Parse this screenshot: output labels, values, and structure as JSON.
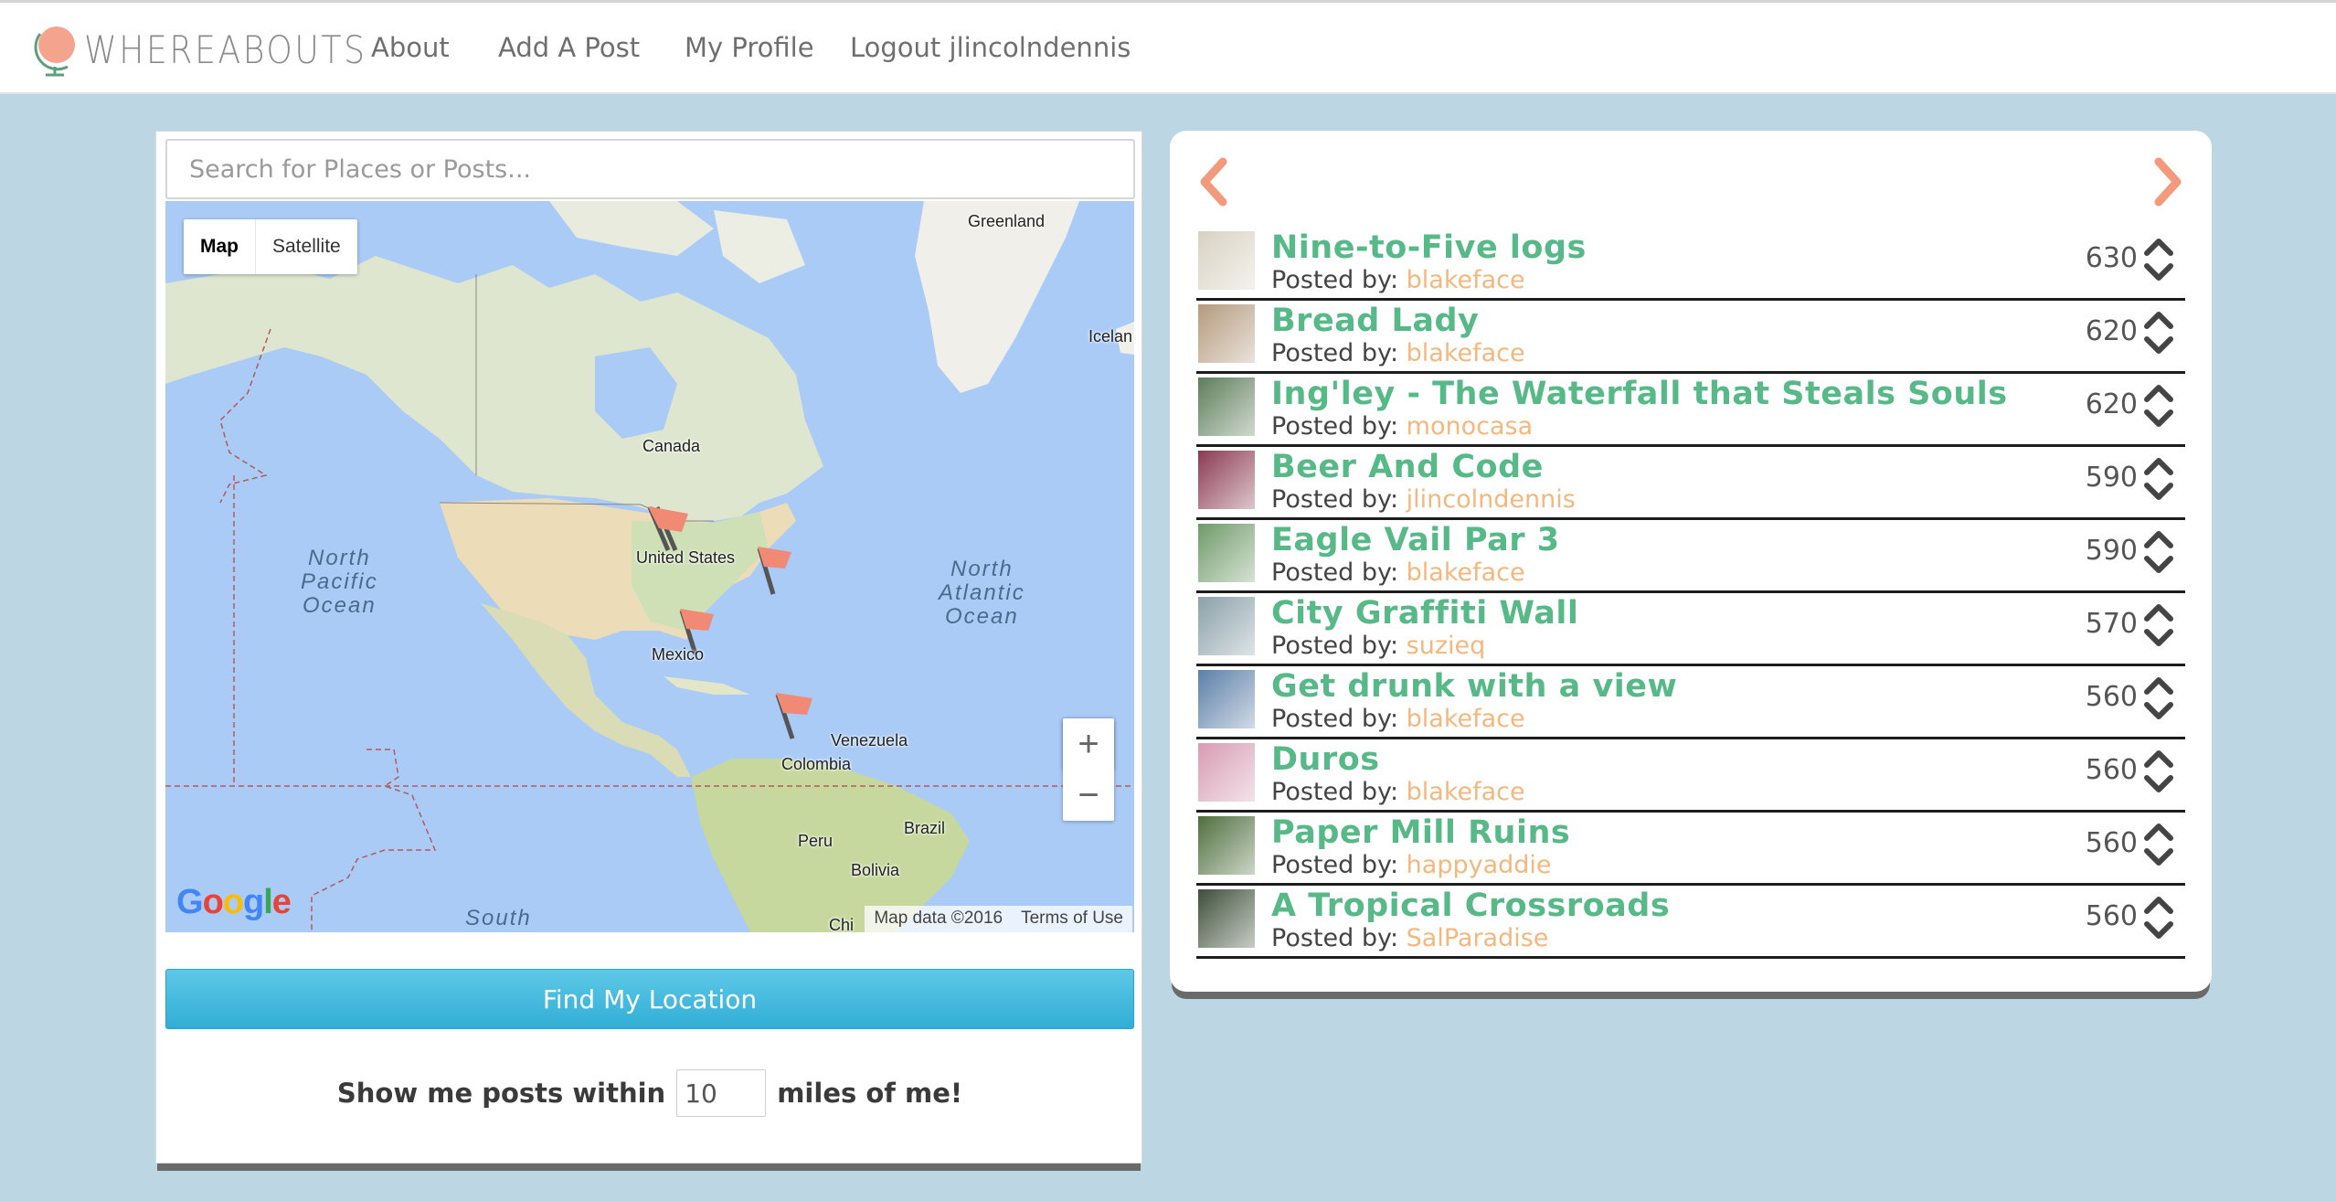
{
  "brand": {
    "name": "WHEREABOUTS"
  },
  "nav": {
    "about": "About",
    "add_post": "Add A Post",
    "profile": "My Profile",
    "logout": "Logout jlincolndennis"
  },
  "search": {
    "placeholder": "Search for Places or Posts..."
  },
  "map": {
    "type_map": "Map",
    "type_satellite": "Satellite",
    "labels": {
      "greenland": "Greenland",
      "iceland": "Icelan",
      "canada": "Canada",
      "united_states": "United States",
      "mexico": "Mexico",
      "venezuela": "Venezuela",
      "colombia": "Colombia",
      "brazil": "Brazil",
      "peru": "Peru",
      "bolivia": "Bolivia",
      "chile": "Chi"
    },
    "oceans": {
      "north_pacific": "North\nPacific\nOcean",
      "north_atlantic": "North\nAtlantic\nOcean",
      "south": "South"
    },
    "zoom_in": "+",
    "zoom_out": "−",
    "google": [
      "G",
      "o",
      "o",
      "g",
      "l",
      "e"
    ],
    "map_data": "Map data ©2016",
    "terms": "Terms of Use"
  },
  "find_location": "Find My Location",
  "radius": {
    "prefix": "Show me posts within",
    "value": "10",
    "suffix": "miles of me!"
  },
  "posts": [
    {
      "title": "Nine-to-Five logs",
      "by_label": "Posted by: ",
      "author": "blakeface",
      "score": "630",
      "thumb": "#d8d2c2"
    },
    {
      "title": "Bread Lady",
      "by_label": "Posted by: ",
      "author": "blakeface",
      "score": "620",
      "thumb": "#b49a7e"
    },
    {
      "title": "Ing'ley - The Waterfall that Steals Souls",
      "by_label": "Posted by: ",
      "author": "monocasa",
      "score": "620",
      "thumb": "#5d7d5a"
    },
    {
      "title": "Beer And Code",
      "by_label": "Posted by: ",
      "author": "jlincolndennis",
      "score": "590",
      "thumb": "#8a3a52"
    },
    {
      "title": "Eagle Vail Par 3",
      "by_label": "Posted by: ",
      "author": "blakeface",
      "score": "590",
      "thumb": "#6f9a6a"
    },
    {
      "title": "City Graffiti Wall",
      "by_label": "Posted by: ",
      "author": "suzieq",
      "score": "570",
      "thumb": "#8aa0a8"
    },
    {
      "title": "Get drunk with a view",
      "by_label": "Posted by: ",
      "author": "blakeface",
      "score": "560",
      "thumb": "#5c7fa8"
    },
    {
      "title": "Duros",
      "by_label": "Posted by: ",
      "author": "blakeface",
      "score": "560",
      "thumb": "#d79cb2"
    },
    {
      "title": "Paper Mill Ruins",
      "by_label": "Posted by: ",
      "author": "happyaddie",
      "score": "560",
      "thumb": "#4f6e3e"
    },
    {
      "title": "A Tropical Crossroads",
      "by_label": "Posted by: ",
      "author": "SalParadise",
      "score": "560",
      "thumb": "#3e4f3a"
    }
  ],
  "colors": {
    "accent_green": "#56b987",
    "author_orange": "#f4b77e",
    "arrow_salmon": "#f49a7c",
    "flag_salmon": "#f08a75",
    "button_blue": "#3fb6dc",
    "background": "#bcd6e3"
  },
  "icons": {
    "brand": "globe-icon",
    "prev": "chevron-left-icon",
    "next": "chevron-right-icon",
    "upvote": "chevron-up-icon",
    "downvote": "chevron-down-icon",
    "pegman": "pegman-icon",
    "marker": "flag-marker-icon"
  }
}
